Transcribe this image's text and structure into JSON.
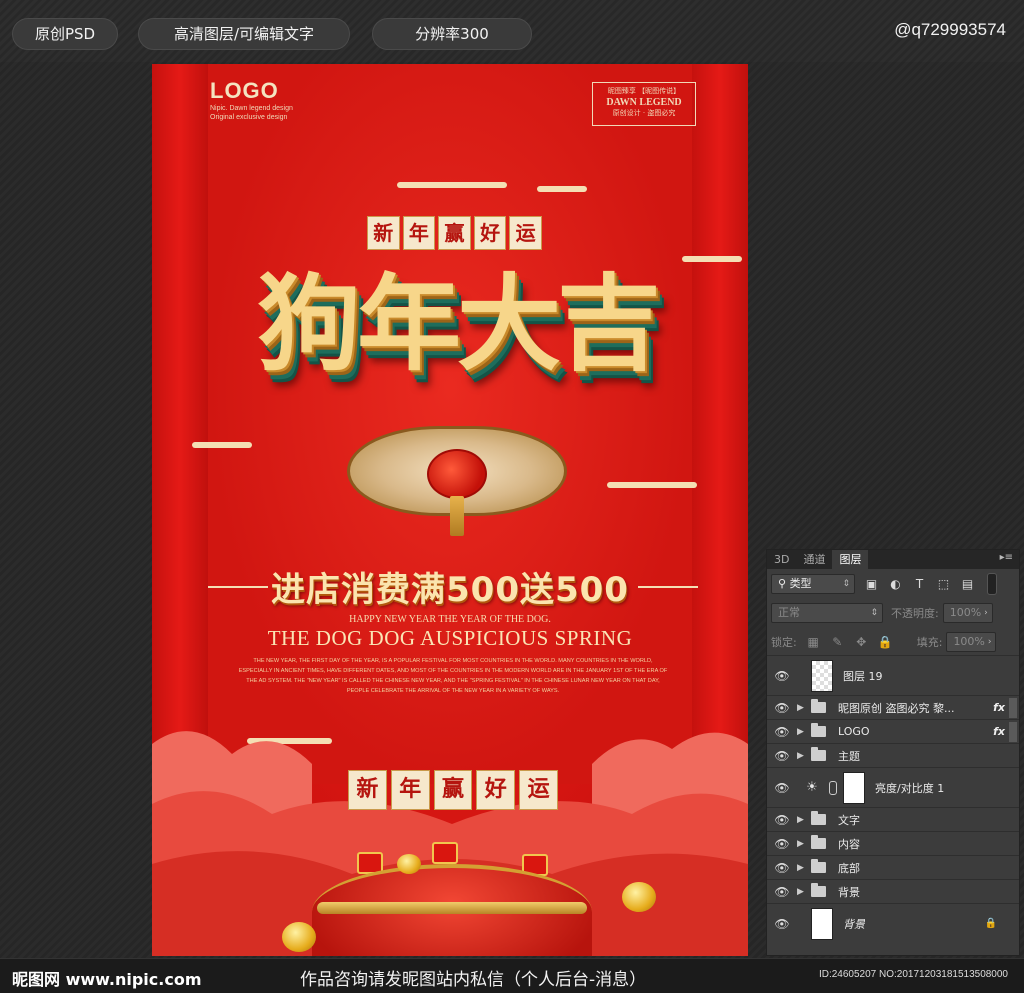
{
  "top_bar": {
    "tags": [
      "原创PSD",
      "高清图层/可编辑文字",
      "分辨率300"
    ],
    "author_handle": "@q729993574"
  },
  "poster": {
    "logo": "LOGO",
    "logo_sub": [
      "Nipic. Dawn legend design",
      "Original exclusive design"
    ],
    "brand_box": [
      "昵图臻享 【昵图传说】",
      "DAWN LEGEND",
      "原创设计 · 盗图必究"
    ],
    "slogan_top": [
      "新",
      "年",
      "赢",
      "好",
      "运"
    ],
    "main_title": "狗年大吉",
    "promo": "进店消费满500送500",
    "eng_small": "HAPPY NEW YEAR THE YEAR OF THE DOG.",
    "eng_big": "THE DOG DOG AUSPICIOUS SPRING",
    "eng_para": "THE NEW YEAR, THE FIRST DAY OF THE YEAR, IS A POPULAR FESTIVAL FOR MOST COUNTRIES IN THE WORLD. MANY COUNTRIES IN THE WORLD, ESPECIALLY IN ANCIENT TIMES, HAVE DIFFERENT DATES, AND MOST OF THE COUNTRIES IN THE MODERN WORLD ARE IN THE JANUARY 1ST OF THE ERA OF THE AD SYSTEM. THE \"NEW YEAR\" IS CALLED THE CHINESE NEW YEAR, AND THE \"SPRING FESTIVAL\" IN THE CHINESE LUNAR NEW YEAR ON THAT DAY, PEOPLE CELEBRATE THE ARRIVAL OF THE NEW YEAR IN A VARIETY OF WAYS.",
    "slogan_bottom": [
      "新",
      "年",
      "赢",
      "好",
      "运"
    ],
    "colors": {
      "red": "#d41511",
      "gold": "#f7d68a",
      "cream": "#f6e8cc"
    }
  },
  "layers_panel": {
    "tabs": [
      "3D",
      "通道",
      "图层"
    ],
    "active_tab": "图层",
    "filter_kind": "类型",
    "blend_mode": "正常",
    "opacity_label": "不透明度:",
    "opacity_value": "100%",
    "lock_label": "锁定:",
    "fill_label": "填充:",
    "fill_value": "100%",
    "layers": [
      {
        "name": "图层 19",
        "kind": "pixel",
        "fx": false
      },
      {
        "name": "昵图原创 盗图必究 黎...",
        "kind": "group",
        "fx": true
      },
      {
        "name": "LOGO",
        "kind": "group",
        "fx": true
      },
      {
        "name": "主题",
        "kind": "group",
        "fx": false
      },
      {
        "name": "亮度/对比度 1",
        "kind": "adjustment",
        "fx": false
      },
      {
        "name": "文字",
        "kind": "group",
        "fx": false
      },
      {
        "name": "内容",
        "kind": "group",
        "fx": false
      },
      {
        "name": "底部",
        "kind": "group",
        "fx": false
      },
      {
        "name": "背景",
        "kind": "group",
        "fx": false
      },
      {
        "name": "背景",
        "kind": "background",
        "fx": false,
        "locked": true
      }
    ],
    "fx_label": "fx"
  },
  "bottom_bar": {
    "site": "昵图网 www.nipic.com",
    "notice": "作品咨询请发昵图站内私信（个人后台-消息）",
    "id_text": "ID:24605207 NO:20171203181513508000"
  }
}
